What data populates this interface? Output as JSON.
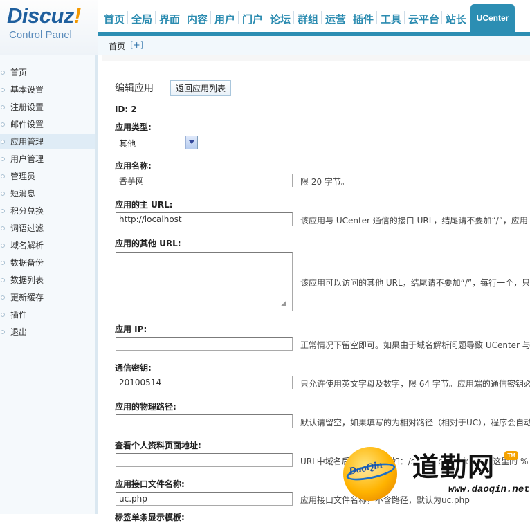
{
  "logo": {
    "main": "Discuz",
    "bang": "!",
    "sub": "Control Panel"
  },
  "nav": {
    "items": [
      "首页",
      "全局",
      "界面",
      "内容",
      "用户",
      "门户",
      "论坛",
      "群组",
      "运营",
      "插件",
      "工具",
      "云平台",
      "站长"
    ],
    "active": "UCenter"
  },
  "breadcrumb": {
    "home": "首页",
    "add": "[+]"
  },
  "sidebar": {
    "items": [
      "首页",
      "基本设置",
      "注册设置",
      "邮件设置",
      "应用管理",
      "用户管理",
      "管理员",
      "短消息",
      "积分兑换",
      "词语过滤",
      "域名解析",
      "数据备份",
      "数据列表",
      "更新缓存",
      "插件",
      "退出"
    ],
    "active_index": 4
  },
  "form": {
    "title": "编辑应用",
    "back_button": "返回应用列表",
    "id_label": "ID: 2",
    "type": {
      "label": "应用类型:",
      "value": "其他"
    },
    "name": {
      "label": "应用名称:",
      "value": "香芋网",
      "tip": "限 20 字节。"
    },
    "main_url": {
      "label": "应用的主 URL:",
      "value": "http://localhost",
      "tip": "该应用与 UCenter 通信的接口 URL，结尾请不要加“/”，应用"
    },
    "other_url": {
      "label": "应用的其他 URL:",
      "value": "",
      "tip": "该应用可以访问的其他 URL，结尾请不要加“/”，每行一个，只"
    },
    "ip": {
      "label": "应用 IP:",
      "value": "",
      "tip": "正常情况下留空即可。如果由于域名解析问题导致 UCenter 与"
    },
    "key": {
      "label": "通信密钥:",
      "value": "20100514",
      "tip": "只允许使用英文字母及数字，限 64 字节。应用端的通信密钥必"
    },
    "path": {
      "label": "应用的物理路径:",
      "value": "",
      "tip": "默认请留空，如果填写的为相对路径（相对于UC），程序会自动"
    },
    "profile_url": {
      "label": "查看个人资料页面地址:",
      "value": "",
      "tip": "URL中域名后面的部分，如：/space.php?uid=%s 这里的 %"
    },
    "api_file": {
      "label": "应用接口文件名称:",
      "value": "uc.php",
      "tip": "应用接口文件名称，不含路径，默认为uc.php"
    },
    "next_label": "标签单条显示模板:"
  },
  "watermark": {
    "ball_text": "DaoQin",
    "logo_text": "道勤网",
    "tm": "TM",
    "domain": "www.daoqin.net"
  },
  "colors": {
    "accent": "#2c8eb3",
    "nav_text": "#2a8bb0",
    "logo_blue": "#1f5f9e",
    "logo_orange": "#f39800"
  }
}
